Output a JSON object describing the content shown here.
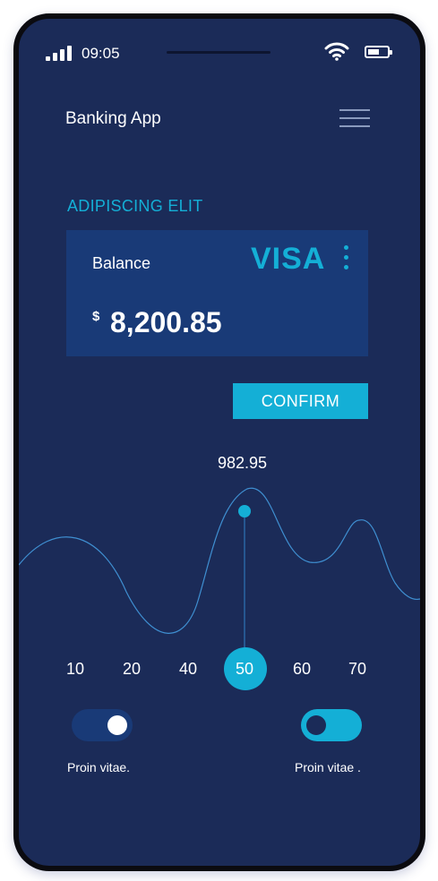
{
  "status_bar": {
    "time": "09:05",
    "signal_icon": "signal-bars-icon",
    "wifi_icon": "wifi-icon",
    "battery_icon": "battery-icon"
  },
  "header": {
    "title": "Banking App",
    "menu_icon": "hamburger-menu-icon"
  },
  "section": {
    "title": "ADIPISCING ELIT"
  },
  "card": {
    "label": "Balance",
    "brand": "VISA",
    "currency": "$",
    "amount": "8,200.85",
    "more_icon": "more-vertical-icon"
  },
  "actions": {
    "confirm_label": "CONFIRM"
  },
  "chart": {
    "selected_value": "982.95",
    "ticks": [
      "10",
      "20",
      "40",
      "50",
      "60",
      "70"
    ],
    "selected_tick": "50"
  },
  "toggles": [
    {
      "label": "Proin vitae.",
      "on": true
    },
    {
      "label": "Proin vitae .",
      "on": false
    }
  ],
  "colors": {
    "background": "#1b2b58",
    "card": "#193a77",
    "accent": "#14afd6",
    "text": "#ffffff"
  }
}
